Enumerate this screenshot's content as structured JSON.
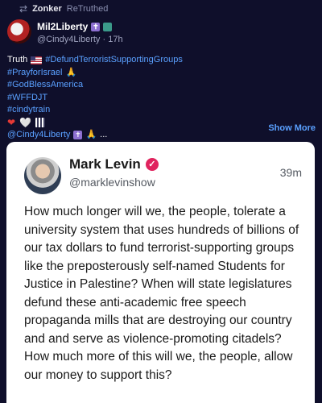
{
  "retruth": {
    "user": "Zonker",
    "label": "ReTruthed",
    "icon": "retruth-icon"
  },
  "poster": {
    "display_name": "Mil2Liberty",
    "emojis": [
      "latin-cross-emoji",
      "square-emoji"
    ],
    "handle": "@Cindy4Liberty",
    "separator": "·",
    "time": "17h"
  },
  "post": {
    "lines": [
      {
        "prefix": "Truth",
        "flag": "us-flag-emoji",
        "hashtag": "#DefundTerroristSupportingGroups"
      },
      {
        "hashtag": "#PrayforIsrael",
        "emoji": "🙏"
      },
      {
        "hashtag": "#GodBlessAmerica"
      },
      {
        "hashtag": "#WFFDJT"
      },
      {
        "hashtag": "#cindytrain"
      },
      {
        "emojis": [
          "❤",
          "🤍",
          "pattern-emoji"
        ]
      },
      {
        "mention": "@Cindy4Liberty",
        "emojis": [
          "latin-cross-emoji",
          "🙏"
        ],
        "ellipsis": "..."
      }
    ],
    "show_more": "Show More"
  },
  "embed": {
    "name": "Mark Levin",
    "verified_icon": "verified-badge-icon",
    "handle": "@marklevinshow",
    "time": "39m",
    "body": "How much longer will we, the people, tolerate a university system that uses hundreds of billions of our tax dollars to fund terrorist-supporting groups like the preposterously self-named Students for Justice in Palestine? When will state legislatures defund these anti-academic free speech propaganda mills that are destroying our country and and serve as violence-promoting citadels? How much more of this will we, the people, allow our money to support this?"
  },
  "colors": {
    "background": "#0f0f2b",
    "link": "#5aa0ff",
    "card": "#ffffff",
    "verified": "#e0245e"
  }
}
